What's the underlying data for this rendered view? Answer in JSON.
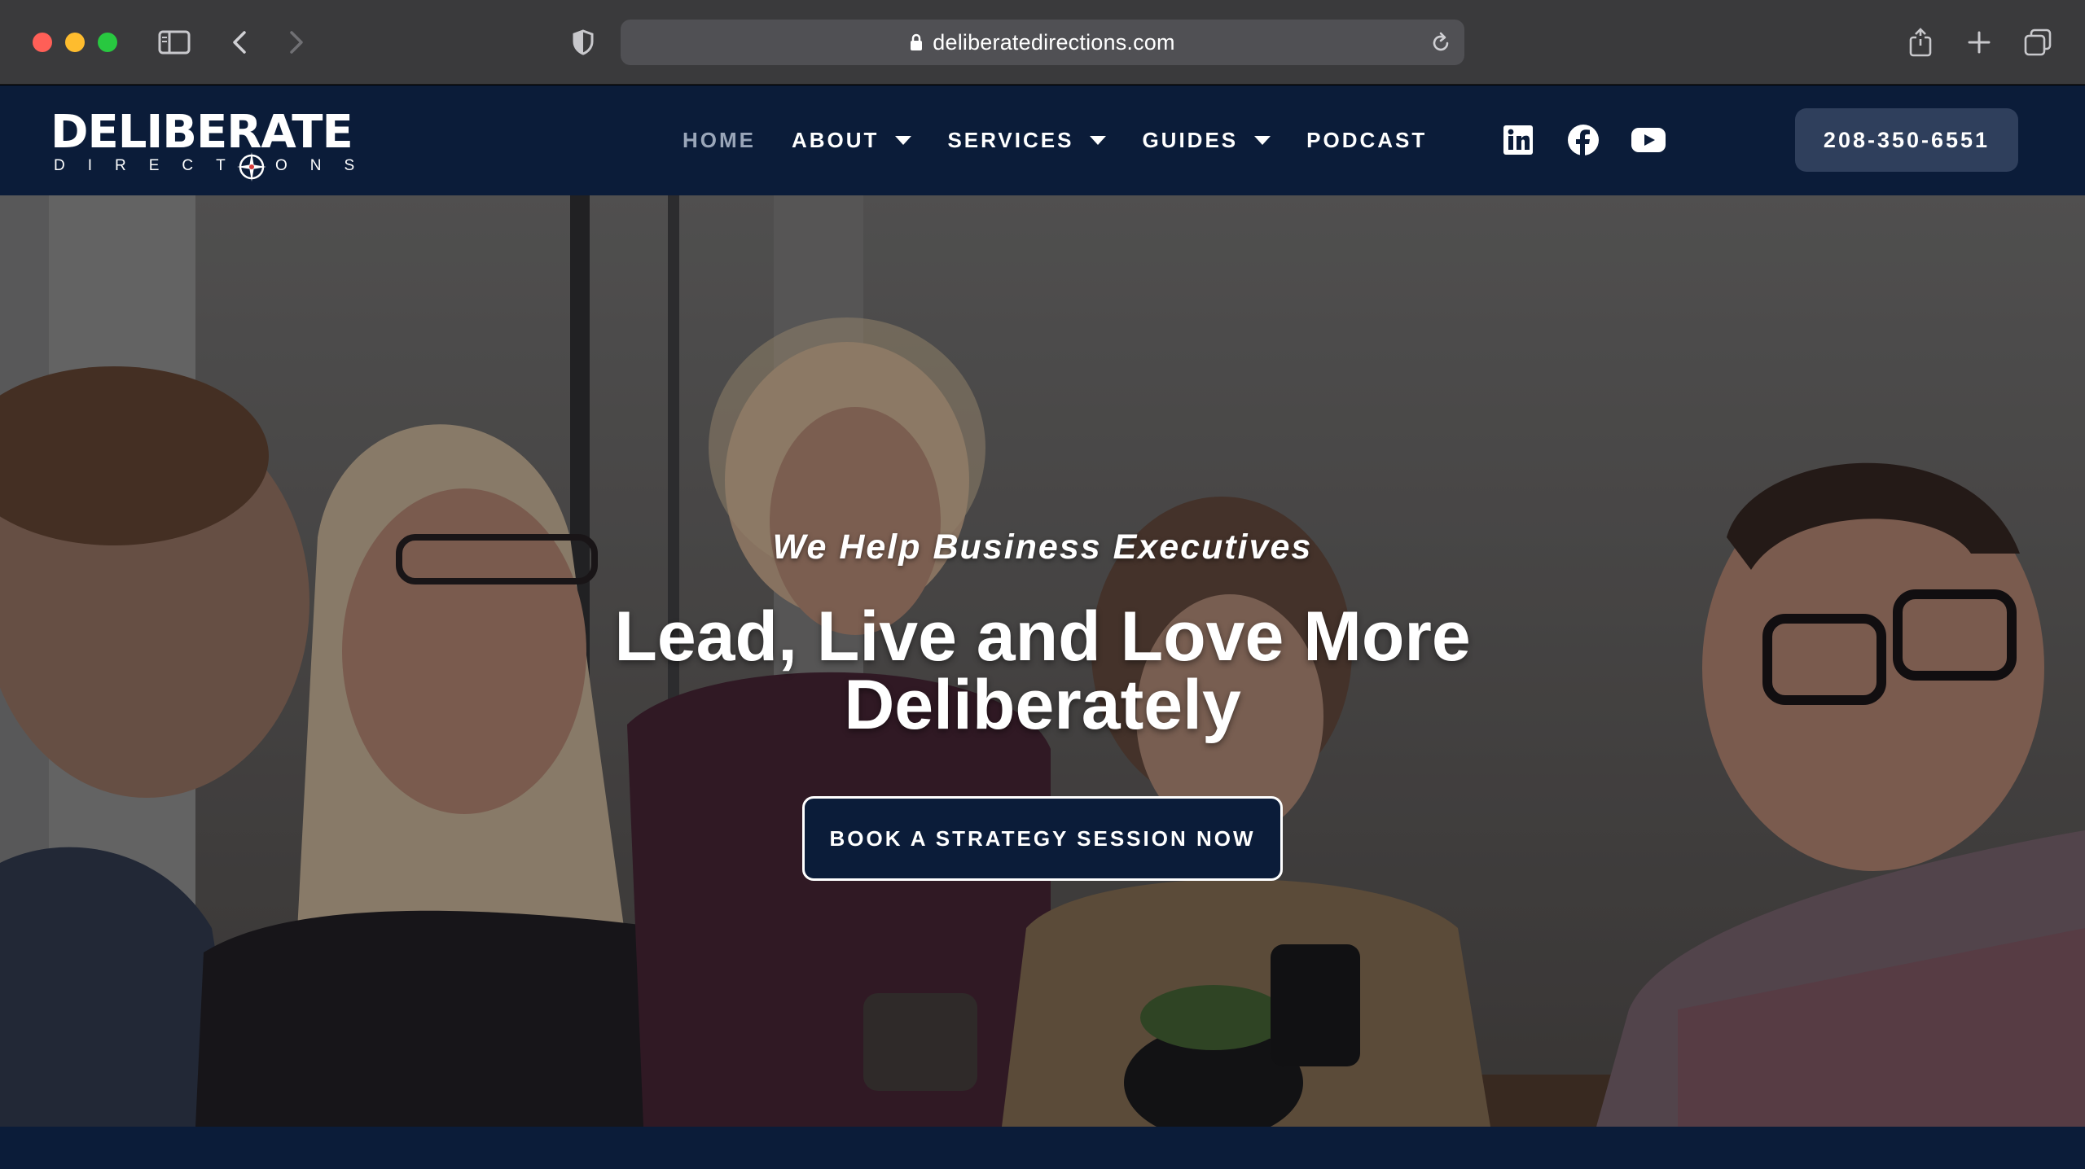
{
  "browser": {
    "url": "deliberatedirections.com"
  },
  "site": {
    "logo_main": "DELIBERATE",
    "logo_sub": "DIRECTIONS",
    "nav": [
      {
        "label": "HOME",
        "active": true
      },
      {
        "label": "ABOUT",
        "dropdown": true
      },
      {
        "label": "SERVICES",
        "dropdown": true
      },
      {
        "label": "GUIDES",
        "dropdown": true
      },
      {
        "label": "PODCAST"
      }
    ],
    "social": [
      "linkedin-icon",
      "facebook-icon",
      "youtube-icon"
    ],
    "phone": "208-350-6551"
  },
  "hero": {
    "subtitle": "We Help Business Executives",
    "title": "Lead, Live and Love More Deliberately",
    "cta_label": "BOOK A STRATEGY SESSION NOW"
  },
  "colors": {
    "navy": "#0b1c39",
    "phone_button": "#2f3f5c",
    "nav_active": "#9aa6b9"
  }
}
